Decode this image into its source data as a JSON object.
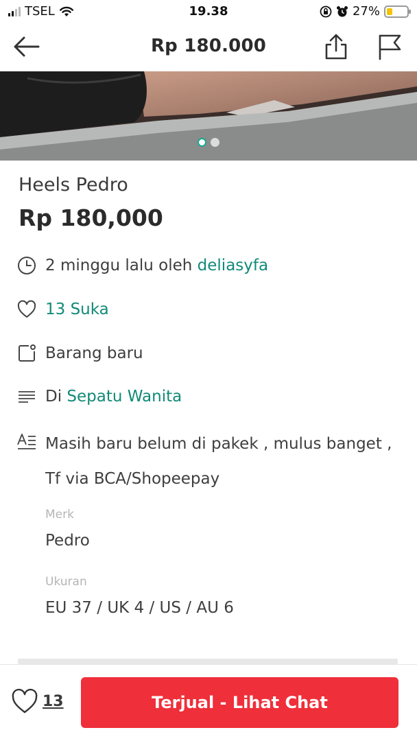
{
  "status_bar": {
    "carrier": "TSEL",
    "time": "19.38",
    "battery_percent": "27%",
    "battery_level": 0.27
  },
  "header": {
    "title": "Rp 180.000",
    "icons": [
      "back-arrow-icon",
      "share-icon",
      "flag-icon"
    ]
  },
  "carousel": {
    "total_images": 2,
    "active_index": 0
  },
  "product": {
    "title": "Heels Pedro",
    "price": "Rp 180,000"
  },
  "info": {
    "posted_prefix": "2 minggu lalu oleh ",
    "seller": "deliasyfa",
    "likes_label": "13 Suka",
    "condition": "Barang baru",
    "category_prefix": "Di ",
    "category": "Sepatu Wanita",
    "description": "Masih baru belum di pakek , mulus banget , Tf via BCA/Shopeepay"
  },
  "fields": [
    {
      "label": "Merk",
      "value": "Pedro"
    },
    {
      "label": "Ukuran",
      "value": "EU 37 / UK 4 / US / AU 6"
    }
  ],
  "bottom_bar": {
    "like_count": "13",
    "chat_button_label": "Terjual - Lihat Chat"
  },
  "colors": {
    "accent": "#118a78",
    "button": "#ef2f3a",
    "battery": "#f5c400"
  }
}
